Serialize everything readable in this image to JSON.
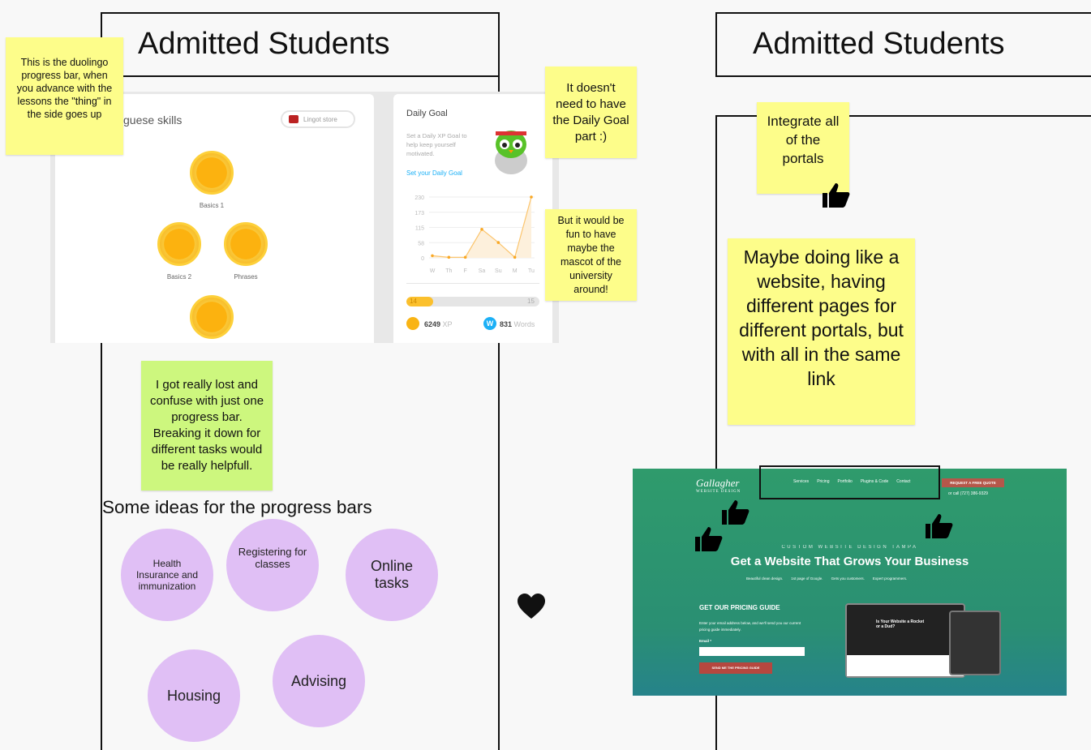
{
  "left_frame": {
    "title": "Admitted Students"
  },
  "right_frame": {
    "title": "Admitted Students"
  },
  "duolingo": {
    "skills_heading": "guese skills",
    "lingot_store": "Lingot store",
    "skills": [
      "Basics 1",
      "Basics 2",
      "Phrases"
    ],
    "daily_goal": {
      "title": "Daily Goal",
      "description": "Set a Daily XP Goal to help keep yourself motivated.",
      "link": "Set your Daily Goal",
      "y_ticks": [
        "230",
        "173",
        "115",
        "58",
        "0"
      ],
      "days": [
        "W",
        "Th",
        "F",
        "Sa",
        "Su",
        "M",
        "Tu"
      ],
      "values": [
        8,
        2,
        2,
        108,
        58,
        2,
        230
      ],
      "ymax": 230,
      "progress_current": "14",
      "progress_goal": "15",
      "progress_fraction": 0.2,
      "xp_value": "6249",
      "xp_unit": "XP",
      "words_value": "831",
      "words_unit": "Words"
    }
  },
  "stickies": {
    "duolingo_note": "This is the duolingo progress bar, when you advance with the lessons the \"thing\" in the side goes up",
    "daily_goal_note": "It doesn't need to have the Daily Goal part :)",
    "mascot_note": "But it would be fun to have maybe the mascot of the university around!",
    "lost_note": "I got really lost and confuse with just one progress bar. Breaking it down for different tasks would be really helpfull.",
    "integrate_note": "Integrate all of the portals",
    "website_note": "Maybe doing like a website, having different pages for different portals, but with all in the same link"
  },
  "ideas": {
    "heading": "Some ideas for the progress bars",
    "items": [
      "Health Insurance and immunization",
      "Registering for classes",
      "Online tasks",
      "Housing",
      "Advising"
    ]
  },
  "website": {
    "logo": "Gallagher",
    "logo_sub": "WEBSITE DESIGN",
    "nav": [
      "Services",
      "Pricing",
      "Portfolio",
      "Plugins & Code",
      "Contact"
    ],
    "quote_button": "REQUEST A FREE QUOTE",
    "phone": "or call (727) 386-9329",
    "kicker": "CUSTOM WEBSITE DESIGN TAMPA",
    "headline": "Get a Website That Grows Your Business",
    "checks": [
      "Beautiful clean design.",
      "1st page of Google.",
      "Gets you customers.",
      "Expert programmers."
    ],
    "pricing_title": "GET OUR PRICING GUIDE",
    "pricing_text": "Enter your email address below, and we'll send you our current pricing guide immediately.",
    "email_label": "Email *",
    "email_value": "",
    "submit": "SEND ME THE PRICING GUIDE",
    "device_headline": "Is Your Website a Rocket or a Dud?"
  },
  "colors": {
    "sticky_yellow": "#fdfd8a",
    "sticky_green": "#cdf77e",
    "idea_circle": "#e0bff5",
    "website_green": "#2f9b6c"
  }
}
